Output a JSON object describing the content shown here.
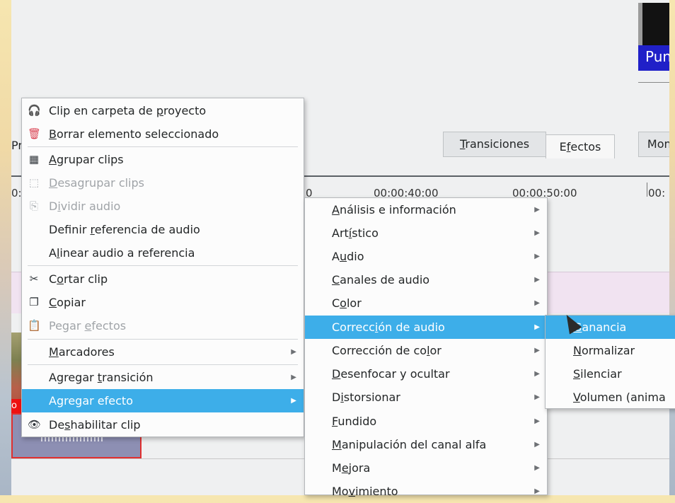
{
  "background_tab_left": "Pr",
  "tabs": [
    {
      "label_pre": "",
      "label_u": "T",
      "label_post": "ransiciones"
    },
    {
      "label_pre": "E",
      "label_u": "f",
      "label_post": "ectos"
    },
    {
      "label_pre": "",
      "label_u": "",
      "label_post": "Moni"
    }
  ],
  "ruler": {
    "left": "0:",
    "zero": "0",
    "t40": "00:00:40:00",
    "t50": "00:00:50:00",
    "t60": "00:"
  },
  "monitor_label": "Punt",
  "clip_label": "o",
  "context_menu": {
    "items": [
      {
        "icon": "folder-audio-icon",
        "glyph": "🎧",
        "pre": "Clip en carpeta de ",
        "u": "p",
        "post": "royecto",
        "disabled": false
      },
      {
        "icon": "trash-icon",
        "glyph": "🗑",
        "pre": "",
        "u": "B",
        "post": "orrar elemento seleccionado",
        "disabled": false
      },
      {
        "icon": "group-icon",
        "glyph": "▦",
        "pre": "",
        "u": "A",
        "post": "grupar clips",
        "disabled": false
      },
      {
        "icon": "ungroup-icon",
        "glyph": "⬚",
        "pre": "",
        "u": "D",
        "post": "esagrupar clips",
        "disabled": true
      },
      {
        "icon": "split-audio-icon",
        "glyph": "⎘",
        "pre": "D",
        "u": "i",
        "post": "vidir audio",
        "disabled": true
      },
      {
        "icon": "",
        "glyph": "",
        "pre": "Definir ",
        "u": "r",
        "post": "eferencia de audio",
        "disabled": false
      },
      {
        "icon": "",
        "glyph": "",
        "pre": "A",
        "u": "l",
        "post": "inear audio a referencia",
        "disabled": false
      },
      {
        "icon": "scissors-icon",
        "glyph": "✂",
        "pre": "C",
        "u": "o",
        "post": "rtar clip",
        "disabled": false
      },
      {
        "icon": "copy-icon",
        "glyph": "❐",
        "pre": "",
        "u": "C",
        "post": "opiar",
        "disabled": false
      },
      {
        "icon": "paste-effects-icon",
        "glyph": "📋",
        "pre": "Pegar ",
        "u": "e",
        "post": "fectos",
        "disabled": true
      },
      {
        "icon": "",
        "glyph": "",
        "pre": "",
        "u": "M",
        "post": "arcadores",
        "disabled": false,
        "submenu": true
      },
      {
        "icon": "",
        "glyph": "",
        "pre": "Agregar ",
        "u": "t",
        "post": "ransición",
        "disabled": false,
        "submenu": true
      },
      {
        "icon": "",
        "glyph": "",
        "pre": "Agregar efecto",
        "u": "",
        "post": "",
        "disabled": false,
        "submenu": true,
        "highlighted": true
      },
      {
        "icon": "eye-icon",
        "glyph": "👁",
        "pre": "De",
        "u": "s",
        "post": "habilitar clip",
        "disabled": false
      }
    ]
  },
  "effects_menu": {
    "items": [
      {
        "pre": "",
        "u": "A",
        "post": "nálisis e información"
      },
      {
        "pre": "Art",
        "u": "í",
        "post": "stico"
      },
      {
        "pre": "A",
        "u": "u",
        "post": "dio"
      },
      {
        "pre": "",
        "u": "C",
        "post": "anales de audio"
      },
      {
        "pre": "C",
        "u": "o",
        "post": "lor"
      },
      {
        "pre": "Correcc",
        "u": "i",
        "post": "ón de audio",
        "highlighted": true
      },
      {
        "pre": "Corrección de co",
        "u": "l",
        "post": "or"
      },
      {
        "pre": "",
        "u": "D",
        "post": "esenfocar y ocultar"
      },
      {
        "pre": "D",
        "u": "i",
        "post": "storsionar"
      },
      {
        "pre": "",
        "u": "F",
        "post": "undido"
      },
      {
        "pre": "",
        "u": "M",
        "post": "anipulación del canal alfa"
      },
      {
        "pre": "M",
        "u": "e",
        "post": "jora"
      },
      {
        "pre": "Mo",
        "u": "v",
        "post": "imiento"
      }
    ]
  },
  "audio_correction_menu": {
    "items": [
      {
        "pre": "",
        "u": "G",
        "post": "anancia",
        "highlighted": true
      },
      {
        "pre": "",
        "u": "N",
        "post": "ormalizar"
      },
      {
        "pre": "",
        "u": "S",
        "post": "ilenciar"
      },
      {
        "pre": "",
        "u": "V",
        "post": "olumen (anima"
      }
    ]
  },
  "arrow_glyph": "▶"
}
